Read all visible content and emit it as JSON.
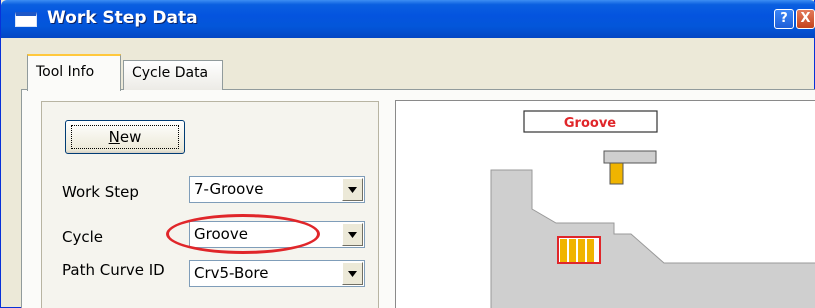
{
  "window": {
    "title": "Work Step Data",
    "help_label": "?",
    "close_label": "X"
  },
  "tabs": [
    {
      "label": "Tool Info",
      "active": true
    },
    {
      "label": "Cycle Data",
      "active": false
    }
  ],
  "tool_info": {
    "new_button_label": "New",
    "new_button_mnemonic": "N",
    "fields": [
      {
        "label": "Work Step",
        "value": "7-Groove"
      },
      {
        "label": "Cycle",
        "value": "Groove"
      },
      {
        "label": "Path Curve ID",
        "value": "Crv5-Bore"
      }
    ]
  },
  "preview": {
    "caption": "Groove",
    "caption_color": "#e0262a",
    "tool_color": "#f0b400",
    "part_color": "#cfcfcf"
  },
  "annotation_color": "#e0262a"
}
